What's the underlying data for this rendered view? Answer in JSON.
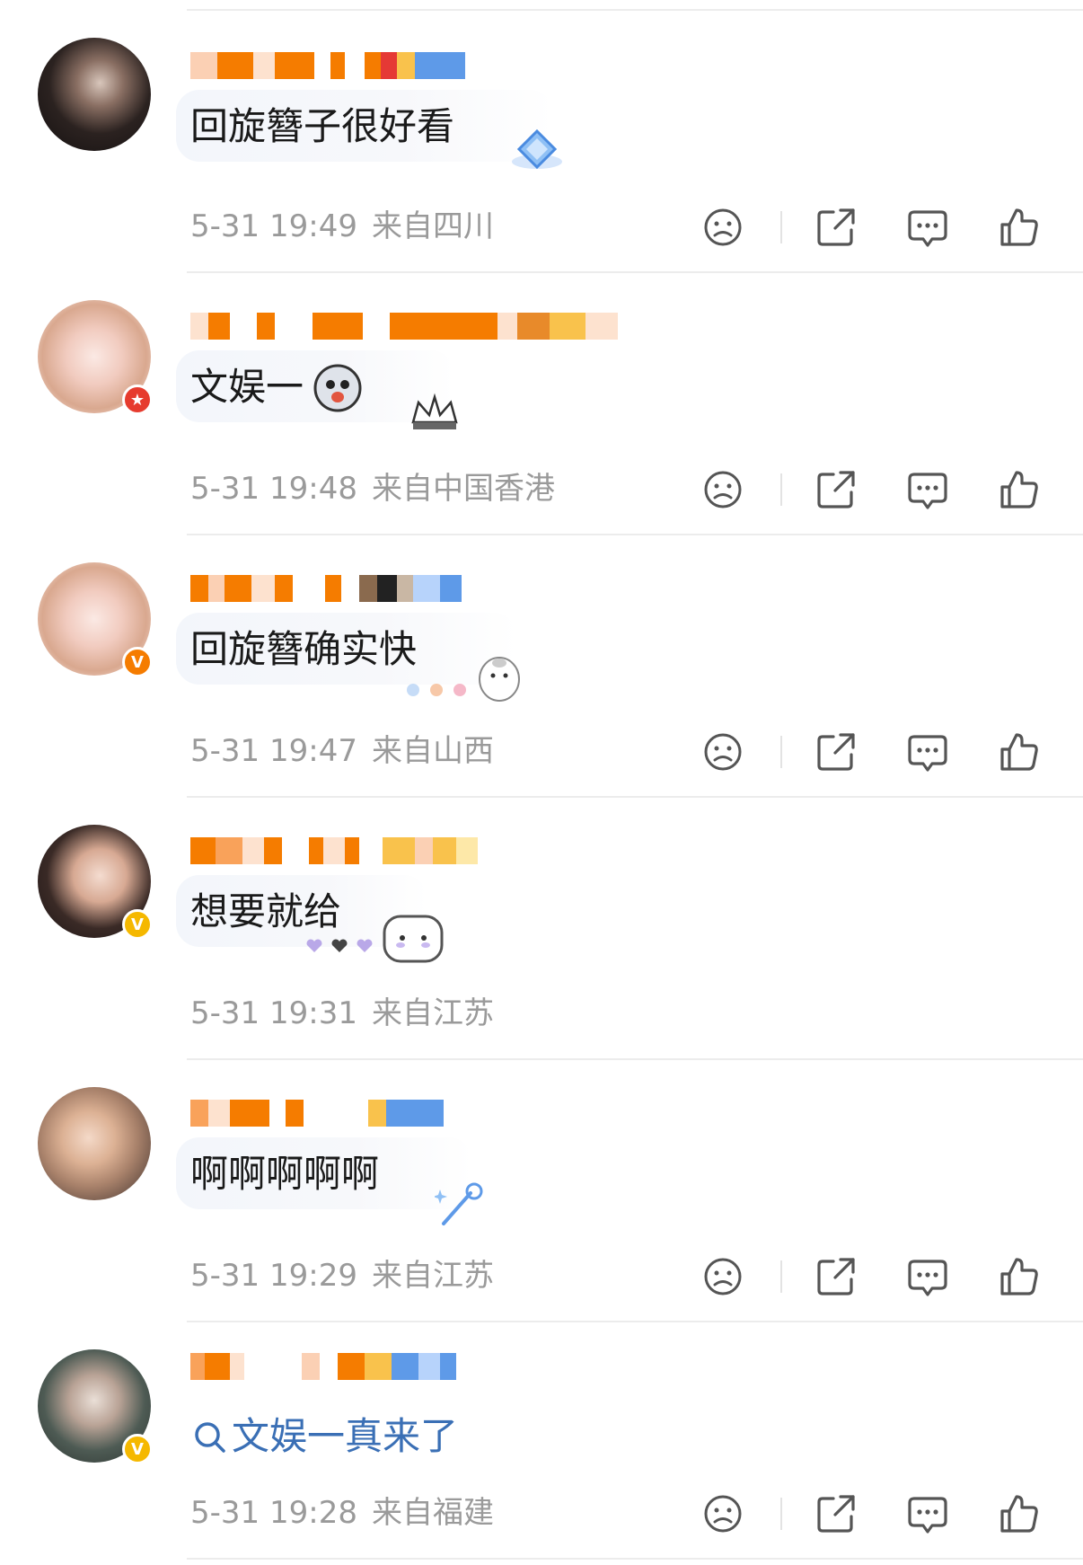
{
  "comments": [
    {
      "text": "回旋簪子很好看",
      "time": "5-31 19:49",
      "location": "来自四川",
      "badge": "",
      "has_actions": true,
      "is_link": false
    },
    {
      "text": "文娱一",
      "time": "5-31 19:48",
      "location": "来自中国香港",
      "badge": "★",
      "has_actions": true,
      "is_link": false
    },
    {
      "text": "回旋簪确实快",
      "time": "5-31 19:47",
      "location": "来自山西",
      "badge": "V",
      "has_actions": true,
      "is_link": false
    },
    {
      "text": "想要就给",
      "time": "5-31 19:31",
      "location": "来自江苏",
      "badge": "V",
      "has_actions": false,
      "is_link": false
    },
    {
      "text": "啊啊啊啊啊",
      "time": "5-31 19:29",
      "location": "来自江苏",
      "badge": "",
      "has_actions": true,
      "is_link": false
    },
    {
      "text": "文娱一真来了",
      "time": "5-31 19:28",
      "location": "来自福建",
      "badge": "V",
      "has_actions": true,
      "is_link": true
    }
  ],
  "icons": {
    "dislike": "sad-face-icon",
    "share": "share-icon",
    "reply": "comment-bubble-icon",
    "like": "thumbs-up-icon",
    "search": "search-icon"
  },
  "colors": {
    "meta_text": "#9a9a9a",
    "link_text": "#3a6fb5",
    "badge_red": "#e63b2e",
    "badge_orange": "#f57c00",
    "badge_gold": "#f5b800",
    "pixelated_name": "#f57c00"
  }
}
